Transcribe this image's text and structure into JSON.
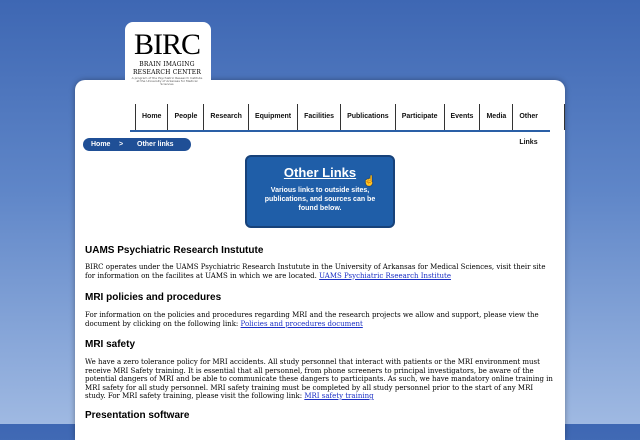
{
  "logo": {
    "title": "BIRC",
    "subtitle_line1": "BRAIN IMAGING",
    "subtitle_line2": "RESEARCH CENTER",
    "tiny_text": "A program of the Psychiatric Research Institute at the University of Arkansas for Medical Sciences"
  },
  "nav": {
    "items": [
      "Home",
      "People",
      "Research",
      "Equipment",
      "Facilities",
      "Publications",
      "Participate",
      "Events",
      "Media",
      "Other Links"
    ]
  },
  "breadcrumb": {
    "home": "Home",
    "separator": ">",
    "current": "Other links"
  },
  "banner": {
    "title": "Other Links",
    "text": "Various links to outside sites, publications, and sources can be found below."
  },
  "sections": {
    "s1": {
      "heading": "UAMS Psychiatric Research Instutute",
      "body": "BIRC operates under the UAMS Psychiatric Research Instutute in the University of Arkansas for Medical Sciences, visit their site for information on the facilites at UAMS in which we are located.",
      "link": "UAMS Psychiatric Rseearch Institute"
    },
    "s2": {
      "heading": "MRI policies and procedures",
      "body": "For information on the policies and procedures regarding MRI and the research projects we allow and support, please view the document by clicking on the following link:",
      "link": "Policies and procedures document"
    },
    "s3": {
      "heading": "MRI safety",
      "body": "We have a zero tolerance policy for MRI accidents. All study personnel that interact with patients or the MRI environment must receive MRI Safety training. It is essential that all personnel, from phone screeners to principal investigators, be aware of the potential dangers of MRI and be able to communicate these dangers to participants. As such, we have mandatory online training in MRI safety for all study personnel. MRI safety training must be completed by all study personnel prior to the start of any MRI study. For MRI safety training, please visit the following link:",
      "link": "MRI safety training"
    },
    "s4": {
      "heading": "Presentation software"
    }
  }
}
